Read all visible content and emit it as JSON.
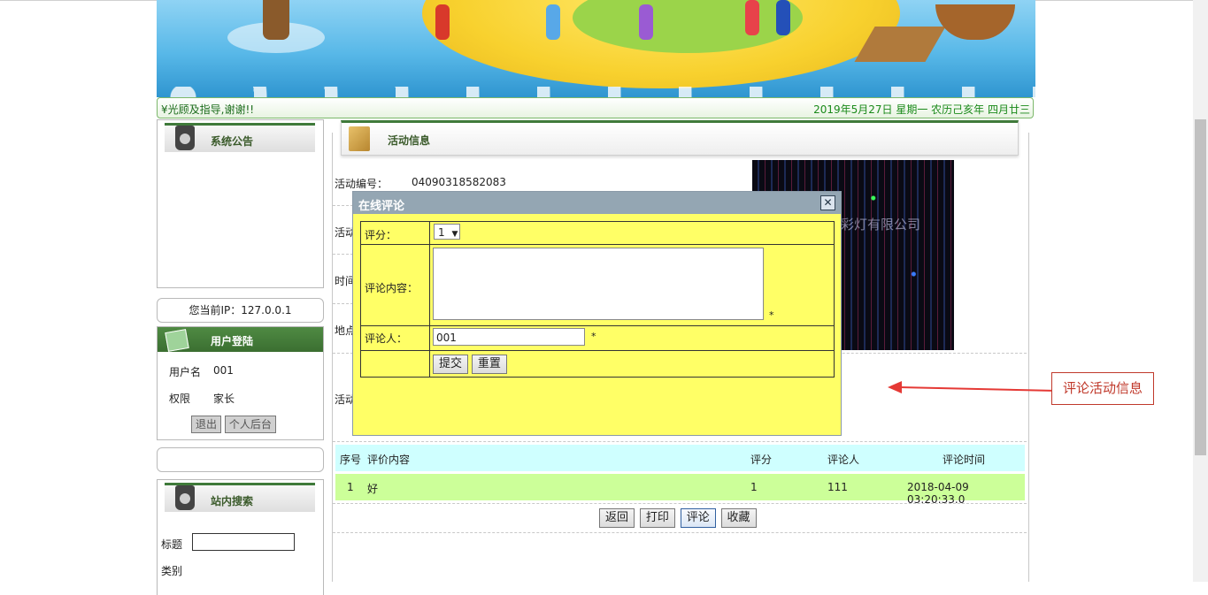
{
  "marquee": {
    "scroll_text": "¥光顾及指导,谢谢!!",
    "date_text": "2019年5月27日 星期一 农历己亥年 四月廿三"
  },
  "sidebar": {
    "notice_title": "系统公告",
    "ip_text": "您当前IP：127.0.0.1",
    "login_title": "用户登陆",
    "username_label": "用户名",
    "username_value": "001",
    "role_label": "权限",
    "role_value": "家长",
    "logout_label": "退出",
    "backend_label": "个人后台",
    "search_title": "站内搜索",
    "search_title_label": "标题",
    "search_category_label": "类别"
  },
  "main": {
    "title": "活动信息",
    "fields": {
      "id_label": "活动编号：",
      "id_value": "04090318582083",
      "name_label": "活动",
      "time_label": "时间",
      "place_label": "地点",
      "content_label": "活动"
    },
    "photo_text": "彩灯有限公司"
  },
  "comments": {
    "headers": [
      "序号",
      "评价内容",
      "评分",
      "评论人",
      "评论时间"
    ],
    "rows": [
      [
        "1",
        "好",
        "1",
        "111",
        "2018-04-09 03:20:33.0"
      ]
    ]
  },
  "actions": {
    "back": "返回",
    "print": "打印",
    "comment": "评论",
    "favorite": "收藏"
  },
  "modal": {
    "title": "在线评论",
    "close": "✕",
    "score_label": "评分：",
    "score_value": "1",
    "content_label": "评论内容：",
    "content_value": "",
    "author_label": "评论人：",
    "author_value": "001",
    "required_mark": "*",
    "submit_label": "提交",
    "reset_label": "重置"
  },
  "annotation": {
    "text": "评论活动信息",
    "color": "#c0392b"
  }
}
